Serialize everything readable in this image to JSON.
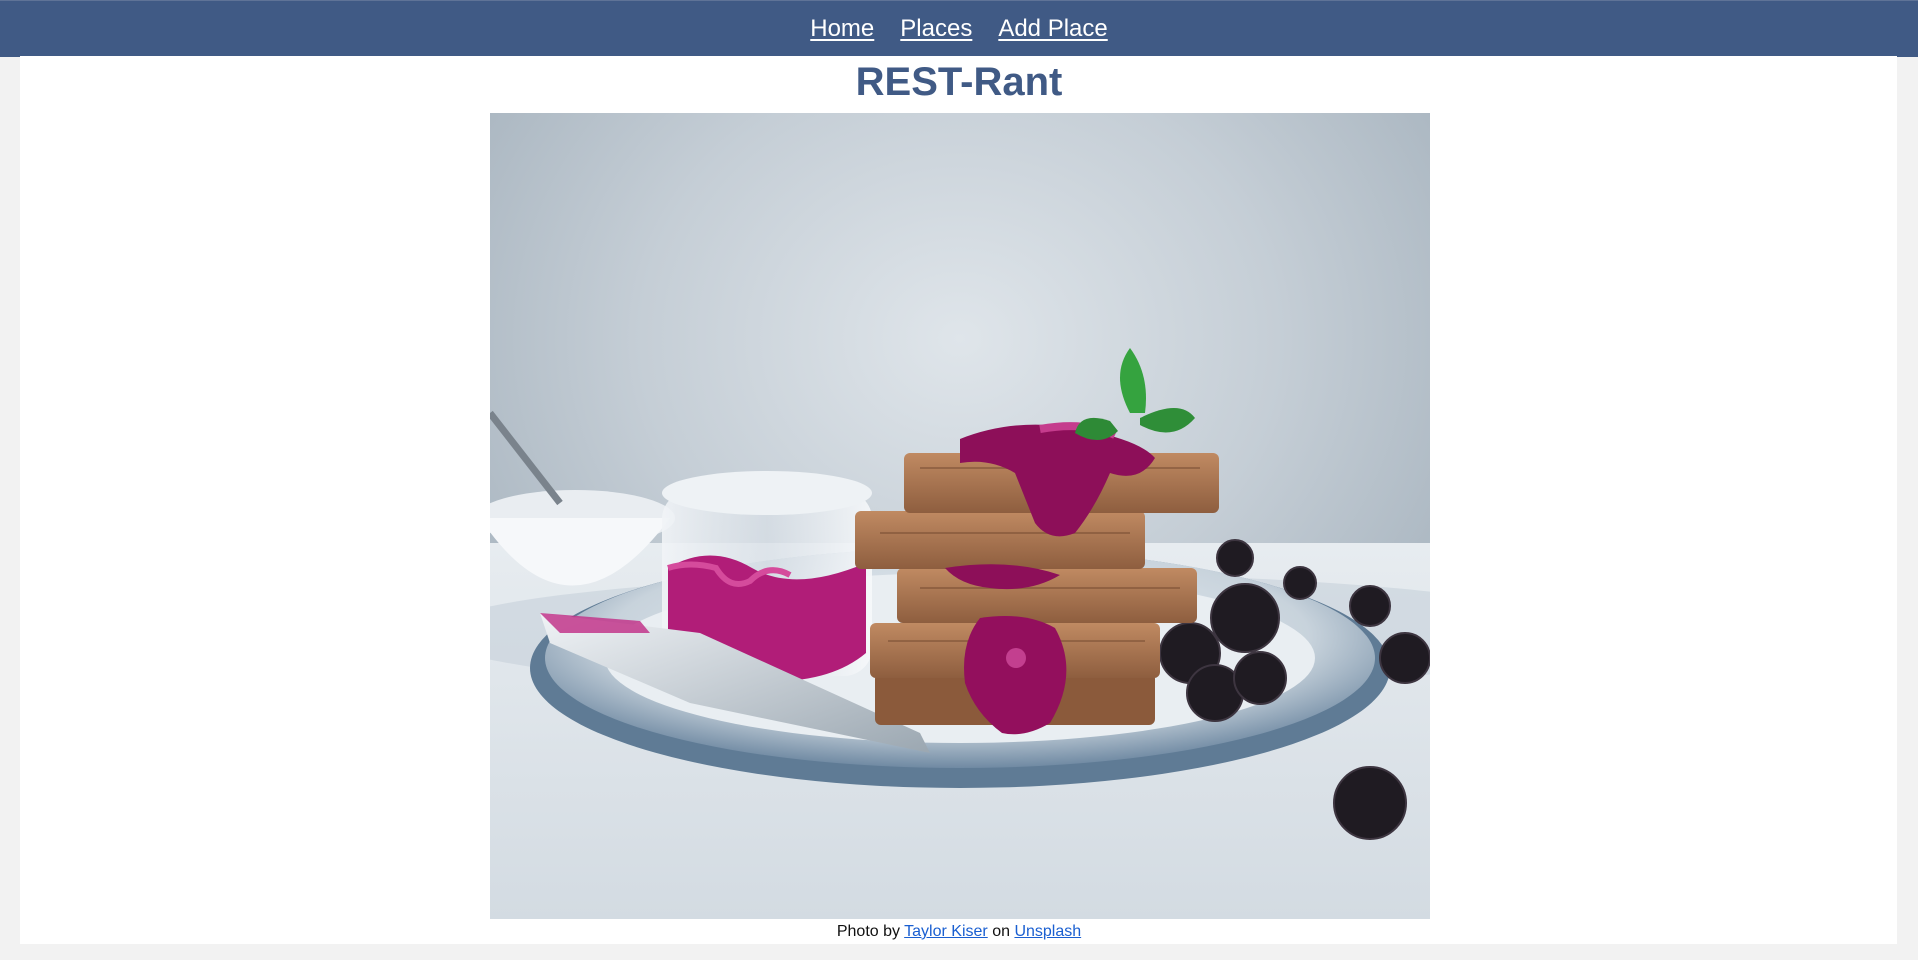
{
  "nav": {
    "items": [
      {
        "label": "Home"
      },
      {
        "label": "Places"
      },
      {
        "label": "Add Place"
      }
    ]
  },
  "page": {
    "title": "REST-Rant"
  },
  "hero": {
    "alt": "waffles with berry jam, blackberries and a knife on a plate"
  },
  "credit": {
    "prefix": "Photo by",
    "author": "Taylor Kiser",
    "middle": "on",
    "site": "Unsplash"
  },
  "colors": {
    "nav_bg": "#405a85",
    "title": "#405a85",
    "link": "#1a5fd1"
  }
}
